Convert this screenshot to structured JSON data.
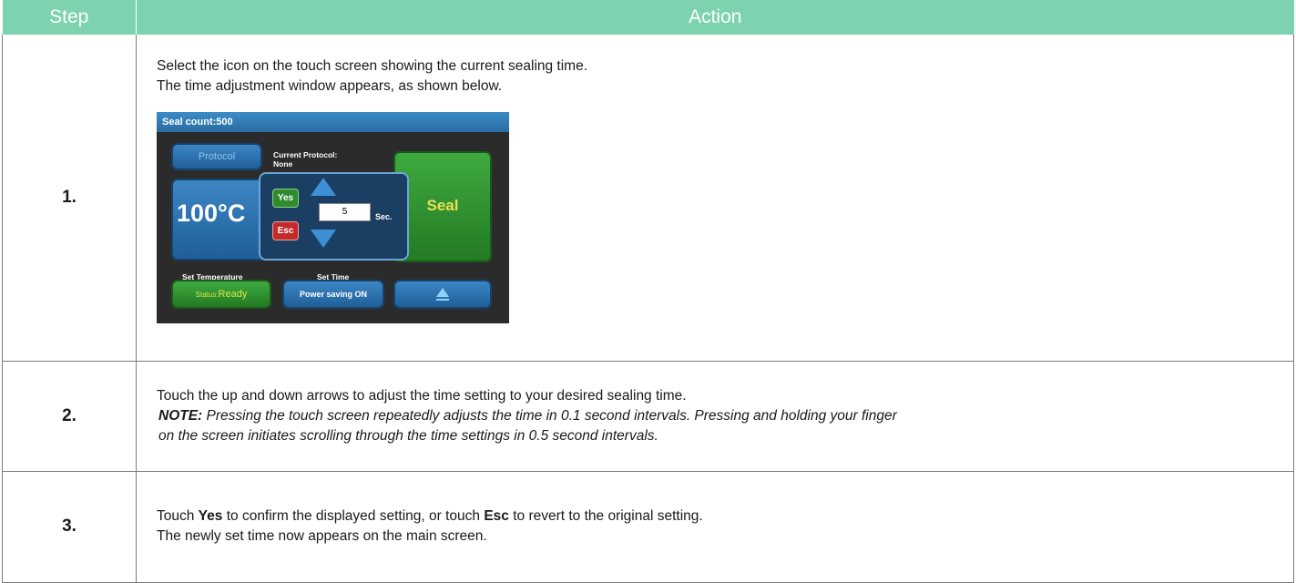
{
  "table": {
    "headers": {
      "step": "Step",
      "action": "Action"
    },
    "rows": [
      {
        "step": "1.",
        "lines": [
          "Select the icon on the touch screen showing the current sealing time.",
          "The time adjustment window appears, as shown below."
        ],
        "device": {
          "top_bar": "Seal count:500",
          "protocol_button": "Protocol",
          "current_protocol_label": "Current Protocol:",
          "current_protocol_value": "None",
          "temperature": "100°C",
          "seal_button": "Seal",
          "set_temperature_label": "Set Temperature",
          "set_time_label": "Set Time",
          "status_prefix": "Status:",
          "status_value": "Ready",
          "power_saving_button": "Power saving ON",
          "popup": {
            "yes": "Yes",
            "esc": "Esc",
            "time_value": "5",
            "unit": "Sec."
          }
        }
      },
      {
        "step": "2.",
        "line": "Touch the up and down arrows to adjust the time setting to your desired sealing time.",
        "note_label": "NOTE:",
        "note_line1": " Pressing the touch screen repeatedly adjusts the time in 0.1 second intervals. Pressing and holding your finger",
        "note_line2": "on the screen initiates scrolling through the time settings in 0.5 second intervals."
      },
      {
        "step": "3.",
        "line_a": "Touch ",
        "kw_yes": "Yes",
        "line_b": " to confirm the displayed setting, or touch ",
        "kw_esc": "Esc",
        "line_c": " to revert to the original setting.",
        "line2": "The newly set time now appears on the main screen."
      }
    ]
  },
  "colors": {
    "header_bg": "#7dd3b0",
    "border": "#7a7a7a"
  }
}
